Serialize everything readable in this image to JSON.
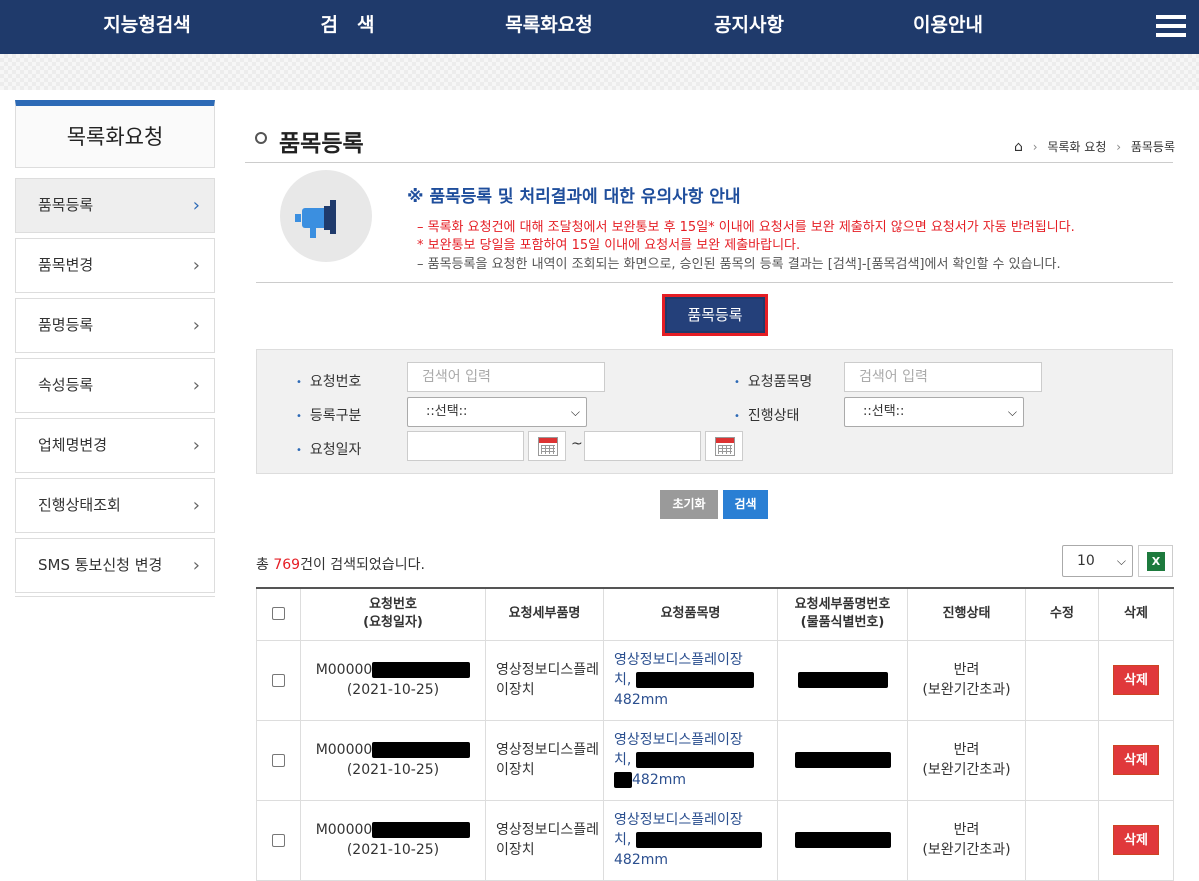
{
  "topnav": {
    "items": [
      "지능형검색",
      "검　색",
      "목록화요청",
      "공지사항",
      "이용안내"
    ]
  },
  "sidebar": {
    "title": "목록화요청",
    "items": [
      {
        "label": "품목등록"
      },
      {
        "label": "품목변경"
      },
      {
        "label": "품명등록"
      },
      {
        "label": "속성등록"
      },
      {
        "label": "업체명변경"
      },
      {
        "label": "진행상태조회"
      },
      {
        "label": "SMS 통보신청 변경"
      }
    ]
  },
  "page": {
    "title": "품목등록",
    "breadcrumb": [
      "목록화 요청",
      "품목등록"
    ]
  },
  "notice": {
    "title": "※ 품목등록 및 처리결과에 대한 유의사항 안내",
    "lines": [
      "– 목록화 요청건에 대해 조달청에서 보완통보 후 15일* 이내에 요청서를 보완 제출하지 않으면 요청서가 자동 반려됩니다.",
      "* 보완통보 당일을 포함하여 15일 이내에 요청서를 보완 제출바랍니다.",
      "– 품목등록을 요청한 내역이 조회되는 화면으로, 승인된 품목의 등록 결과는 [검색]-[품목검색]에서 확인할 수 있습니다."
    ],
    "colors": {
      "red": "#e51e25",
      "gray": "#555555"
    }
  },
  "register_button": "품목등록",
  "search": {
    "req_no_label": "요청번호",
    "req_no_placeholder": "검색어 입력",
    "req_item_label": "요청품목명",
    "req_item_placeholder": "검색어 입력",
    "reg_type_label": "등록구분",
    "reg_type_value": "::선택::",
    "status_label": "진행상태",
    "status_value": "::선택::",
    "date_label": "요청일자",
    "date_sep": "~",
    "reset_label": "초기화",
    "search_label": "검색"
  },
  "results": {
    "prefix": "총 ",
    "count": "769",
    "suffix": "건이 검색되었습니다.",
    "page_size": "10"
  },
  "table": {
    "headers": [
      "요청번호\n(요청일자)",
      "요청세부품명",
      "요청품목명",
      "요청세부품명번호\n(물품식별번호)",
      "진행상태",
      "수정",
      "삭제"
    ],
    "rows": [
      {
        "req_no": "M00000",
        "date": "(2021-10-25)",
        "detail": "영상정보디스플레이장치",
        "item_a": "영상정보디스플레이장",
        "item_b": "치,",
        "item_c": "482mm",
        "status_a": "반려",
        "status_b": "(보완기간초과)",
        "delete": "삭제"
      },
      {
        "req_no": "M00000",
        "date": "(2021-10-25)",
        "detail": "영상정보디스플레이장치",
        "item_a": "영상정보디스플레이장",
        "item_b": "치,",
        "item_c": "482mm",
        "status_a": "반려",
        "status_b": "(보완기간초과)",
        "delete": "삭제"
      },
      {
        "req_no": "M00000",
        "date": "(2021-10-25)",
        "detail": "영상정보디스플레이장치",
        "item_a": "영상정보디스플레이장",
        "item_b": "치,",
        "item_c": "482mm",
        "status_a": "반려",
        "status_b": "(보완기간초과)",
        "delete": "삭제"
      }
    ]
  }
}
